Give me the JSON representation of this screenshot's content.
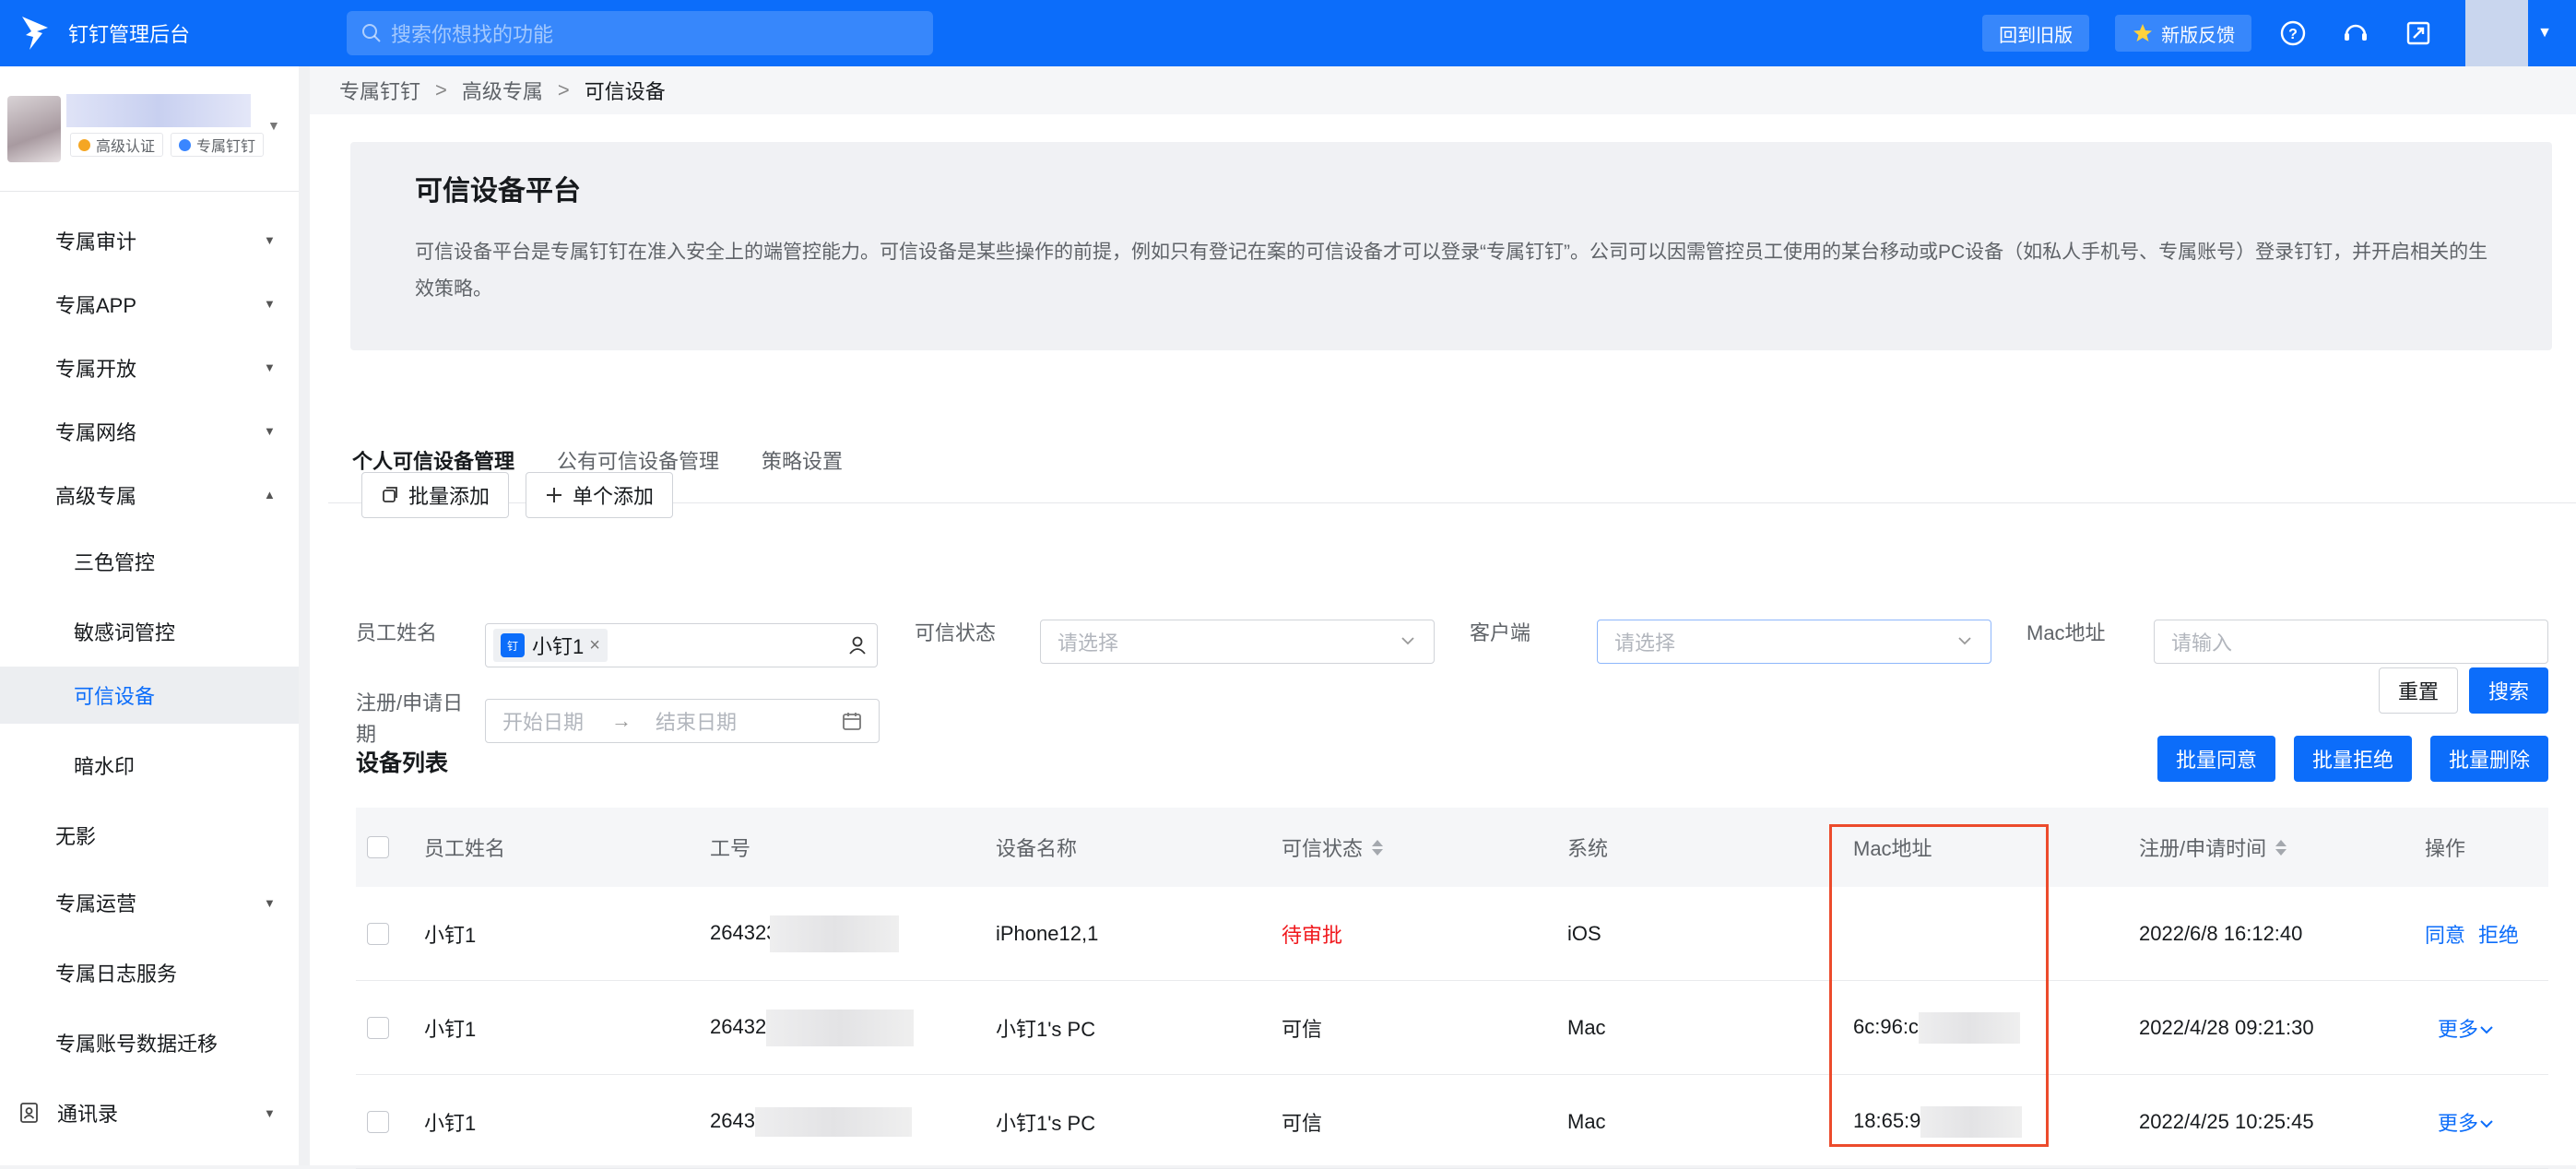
{
  "topbar": {
    "app_title": "钉钉管理后台",
    "search_placeholder": "搜索你想找的功能",
    "back_old_label": "回到旧版",
    "feedback_label": "新版反馈"
  },
  "user": {
    "badge_cert": "高级认证",
    "badge_exclusive": "专属钉钉"
  },
  "sidebar": {
    "items": [
      {
        "label": "专属审计"
      },
      {
        "label": "专属APP"
      },
      {
        "label": "专属开放"
      },
      {
        "label": "专属网络"
      },
      {
        "label": "高级专属"
      },
      {
        "label": "三色管控"
      },
      {
        "label": "敏感词管控"
      },
      {
        "label": "可信设备"
      },
      {
        "label": "暗水印"
      },
      {
        "label": "无影"
      },
      {
        "label": "专属运营"
      },
      {
        "label": "专属日志服务"
      },
      {
        "label": "专属账号数据迁移"
      },
      {
        "label": "通讯录"
      }
    ]
  },
  "breadcrumb": {
    "items": [
      "专属钉钉",
      "高级专属",
      "可信设备"
    ]
  },
  "intro": {
    "title": "可信设备平台",
    "description": "可信设备平台是专属钉钉在准入安全上的端管控能力。可信设备是某些操作的前提，例如只有登记在案的可信设备才可以登录“专属钉钉”。公司可以因需管控员工使用的某台移动或PC设备（如私人手机号、专属账号）登录钉钉，并开启相关的生效策略。"
  },
  "tabs": [
    {
      "label": "个人可信设备管理"
    },
    {
      "label": "公有可信设备管理"
    },
    {
      "label": "策略设置"
    }
  ],
  "actions": {
    "batch_add": "批量添加",
    "single_add": "单个添加"
  },
  "filters": {
    "employee_label": "员工姓名",
    "employee_tag": "小钉1",
    "employee_tag_icon": "钉",
    "status_label": "可信状态",
    "status_placeholder": "请选择",
    "client_label": "客户端",
    "client_placeholder": "请选择",
    "mac_label": "Mac地址",
    "mac_placeholder": "请输入",
    "date_label_line1": "注册/申请日",
    "date_label_line2": "期",
    "start_placeholder": "开始日期",
    "end_placeholder": "结束日期",
    "reset": "重置",
    "search": "搜索"
  },
  "device_list": {
    "title": "设备列表",
    "batch_approve": "批量同意",
    "batch_reject": "批量拒绝",
    "batch_delete": "批量删除",
    "columns": [
      "员工姓名",
      "工号",
      "设备名称",
      "可信状态",
      "系统",
      "Mac地址",
      "注册/申请时间",
      "操作"
    ],
    "rows": [
      {
        "name": "小钉1",
        "job_no": "264323",
        "device": "iPhone12,1",
        "status": "待审批",
        "system": "iOS",
        "mac": "",
        "time": "2022/6/8 16:12:40",
        "op1": "同意",
        "op2": "拒绝"
      },
      {
        "name": "小钉1",
        "job_no": "26432",
        "device": "小钉1's PC",
        "status": "可信",
        "system": "Mac",
        "mac": "6c:96:c",
        "time": "2022/4/28 09:21:30",
        "op1": "更多"
      },
      {
        "name": "小钉1",
        "job_no": "2643",
        "device": "小钉1's PC",
        "status": "可信",
        "system": "Mac",
        "mac": "18:65:9",
        "time": "2022/4/25 10:25:45",
        "op1": "更多"
      }
    ]
  },
  "colors": {
    "primary": "#0c6dfa",
    "pending": "#f0171c",
    "highlight": "#ec4b2c"
  }
}
